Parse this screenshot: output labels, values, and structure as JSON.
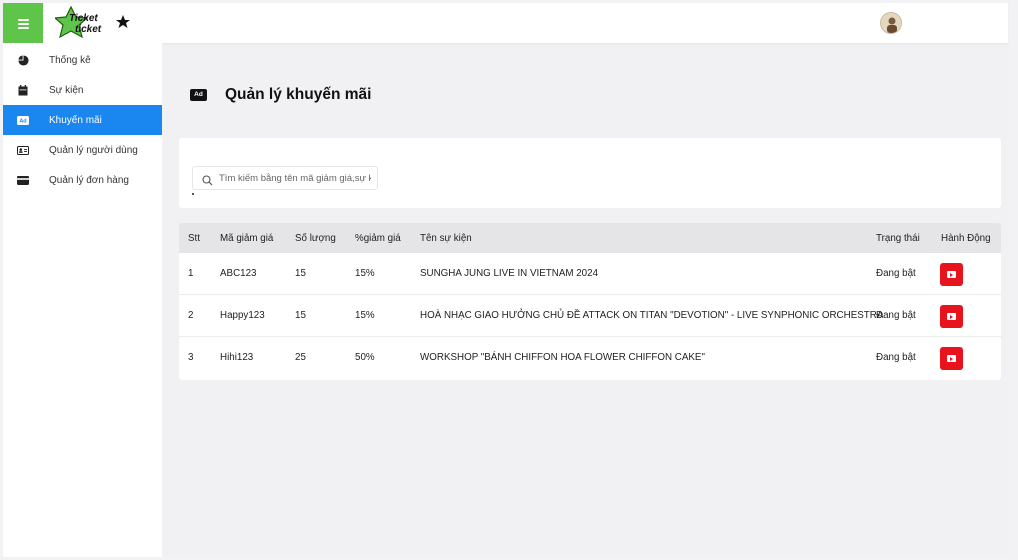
{
  "header": {
    "logo_text": "Ticket ticket",
    "colors": {
      "menu_button": "#5ec54a",
      "active_nav": "#1a86f0",
      "action_button": "#e8141d"
    }
  },
  "sidebar": {
    "items": [
      {
        "label": "Thống kê",
        "icon": "pie-chart-icon",
        "active": false
      },
      {
        "label": "Sự kiện",
        "icon": "calendar-icon",
        "active": false
      },
      {
        "label": "Khuyến mãi",
        "icon": "ad-icon",
        "active": true
      },
      {
        "label": "Quản lý người dùng",
        "icon": "id-card-icon",
        "active": false
      },
      {
        "label": "Quản lý đơn hàng",
        "icon": "credit-card-icon",
        "active": false
      }
    ]
  },
  "main": {
    "title": "Quản lý khuyến mãi",
    "title_icon_text": "Ad",
    "search": {
      "placeholder": "Tìm kiếm bằng tên mã giảm giá,sự k"
    },
    "table": {
      "headers": [
        "Stt",
        "Mã giảm giá",
        "Số lượng",
        "%giảm giá",
        "Tên sự kiện",
        "Trạng thái",
        "Hành Động"
      ],
      "rows": [
        {
          "stt": "1",
          "code": "ABC123",
          "qty": "15",
          "pct": "15%",
          "event": "SUNGHA JUNG LIVE IN VIETNAM 2024",
          "status": "Đang bật"
        },
        {
          "stt": "2",
          "code": "Happy123",
          "qty": "15",
          "pct": "15%",
          "event": "HOÀ NHẠC GIAO HƯỞNG CHỦ ĐỀ ATTACK ON TITAN \"DEVOTION\" - LIVE SYNPHONIC ORCHESTRA",
          "status": "Đang bật"
        },
        {
          "stt": "3",
          "code": "Hihi123",
          "qty": "25",
          "pct": "50%",
          "event": "WORKSHOP \"BÁNH CHIFFON HOA FLOWER CHIFFON CAKE\"",
          "status": "Đang bật"
        }
      ]
    }
  }
}
